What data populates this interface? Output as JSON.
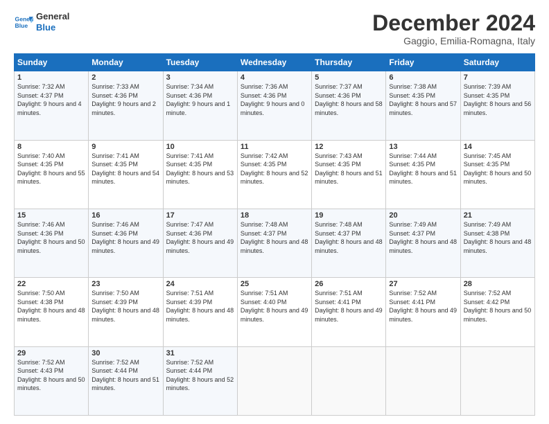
{
  "header": {
    "logo_line1": "General",
    "logo_line2": "Blue",
    "title": "December 2024",
    "subtitle": "Gaggio, Emilia-Romagna, Italy"
  },
  "weekdays": [
    "Sunday",
    "Monday",
    "Tuesday",
    "Wednesday",
    "Thursday",
    "Friday",
    "Saturday"
  ],
  "weeks": [
    [
      {
        "day": "1",
        "rise": "Sunrise: 7:32 AM",
        "set": "Sunset: 4:37 PM",
        "light": "Daylight: 9 hours and 4 minutes."
      },
      {
        "day": "2",
        "rise": "Sunrise: 7:33 AM",
        "set": "Sunset: 4:36 PM",
        "light": "Daylight: 9 hours and 2 minutes."
      },
      {
        "day": "3",
        "rise": "Sunrise: 7:34 AM",
        "set": "Sunset: 4:36 PM",
        "light": "Daylight: 9 hours and 1 minute."
      },
      {
        "day": "4",
        "rise": "Sunrise: 7:36 AM",
        "set": "Sunset: 4:36 PM",
        "light": "Daylight: 9 hours and 0 minutes."
      },
      {
        "day": "5",
        "rise": "Sunrise: 7:37 AM",
        "set": "Sunset: 4:36 PM",
        "light": "Daylight: 8 hours and 58 minutes."
      },
      {
        "day": "6",
        "rise": "Sunrise: 7:38 AM",
        "set": "Sunset: 4:35 PM",
        "light": "Daylight: 8 hours and 57 minutes."
      },
      {
        "day": "7",
        "rise": "Sunrise: 7:39 AM",
        "set": "Sunset: 4:35 PM",
        "light": "Daylight: 8 hours and 56 minutes."
      }
    ],
    [
      {
        "day": "8",
        "rise": "Sunrise: 7:40 AM",
        "set": "Sunset: 4:35 PM",
        "light": "Daylight: 8 hours and 55 minutes."
      },
      {
        "day": "9",
        "rise": "Sunrise: 7:41 AM",
        "set": "Sunset: 4:35 PM",
        "light": "Daylight: 8 hours and 54 minutes."
      },
      {
        "day": "10",
        "rise": "Sunrise: 7:41 AM",
        "set": "Sunset: 4:35 PM",
        "light": "Daylight: 8 hours and 53 minutes."
      },
      {
        "day": "11",
        "rise": "Sunrise: 7:42 AM",
        "set": "Sunset: 4:35 PM",
        "light": "Daylight: 8 hours and 52 minutes."
      },
      {
        "day": "12",
        "rise": "Sunrise: 7:43 AM",
        "set": "Sunset: 4:35 PM",
        "light": "Daylight: 8 hours and 51 minutes."
      },
      {
        "day": "13",
        "rise": "Sunrise: 7:44 AM",
        "set": "Sunset: 4:35 PM",
        "light": "Daylight: 8 hours and 51 minutes."
      },
      {
        "day": "14",
        "rise": "Sunrise: 7:45 AM",
        "set": "Sunset: 4:35 PM",
        "light": "Daylight: 8 hours and 50 minutes."
      }
    ],
    [
      {
        "day": "15",
        "rise": "Sunrise: 7:46 AM",
        "set": "Sunset: 4:36 PM",
        "light": "Daylight: 8 hours and 50 minutes."
      },
      {
        "day": "16",
        "rise": "Sunrise: 7:46 AM",
        "set": "Sunset: 4:36 PM",
        "light": "Daylight: 8 hours and 49 minutes."
      },
      {
        "day": "17",
        "rise": "Sunrise: 7:47 AM",
        "set": "Sunset: 4:36 PM",
        "light": "Daylight: 8 hours and 49 minutes."
      },
      {
        "day": "18",
        "rise": "Sunrise: 7:48 AM",
        "set": "Sunset: 4:37 PM",
        "light": "Daylight: 8 hours and 48 minutes."
      },
      {
        "day": "19",
        "rise": "Sunrise: 7:48 AM",
        "set": "Sunset: 4:37 PM",
        "light": "Daylight: 8 hours and 48 minutes."
      },
      {
        "day": "20",
        "rise": "Sunrise: 7:49 AM",
        "set": "Sunset: 4:37 PM",
        "light": "Daylight: 8 hours and 48 minutes."
      },
      {
        "day": "21",
        "rise": "Sunrise: 7:49 AM",
        "set": "Sunset: 4:38 PM",
        "light": "Daylight: 8 hours and 48 minutes."
      }
    ],
    [
      {
        "day": "22",
        "rise": "Sunrise: 7:50 AM",
        "set": "Sunset: 4:38 PM",
        "light": "Daylight: 8 hours and 48 minutes."
      },
      {
        "day": "23",
        "rise": "Sunrise: 7:50 AM",
        "set": "Sunset: 4:39 PM",
        "light": "Daylight: 8 hours and 48 minutes."
      },
      {
        "day": "24",
        "rise": "Sunrise: 7:51 AM",
        "set": "Sunset: 4:39 PM",
        "light": "Daylight: 8 hours and 48 minutes."
      },
      {
        "day": "25",
        "rise": "Sunrise: 7:51 AM",
        "set": "Sunset: 4:40 PM",
        "light": "Daylight: 8 hours and 49 minutes."
      },
      {
        "day": "26",
        "rise": "Sunrise: 7:51 AM",
        "set": "Sunset: 4:41 PM",
        "light": "Daylight: 8 hours and 49 minutes."
      },
      {
        "day": "27",
        "rise": "Sunrise: 7:52 AM",
        "set": "Sunset: 4:41 PM",
        "light": "Daylight: 8 hours and 49 minutes."
      },
      {
        "day": "28",
        "rise": "Sunrise: 7:52 AM",
        "set": "Sunset: 4:42 PM",
        "light": "Daylight: 8 hours and 50 minutes."
      }
    ],
    [
      {
        "day": "29",
        "rise": "Sunrise: 7:52 AM",
        "set": "Sunset: 4:43 PM",
        "light": "Daylight: 8 hours and 50 minutes."
      },
      {
        "day": "30",
        "rise": "Sunrise: 7:52 AM",
        "set": "Sunset: 4:44 PM",
        "light": "Daylight: 8 hours and 51 minutes."
      },
      {
        "day": "31",
        "rise": "Sunrise: 7:52 AM",
        "set": "Sunset: 4:44 PM",
        "light": "Daylight: 8 hours and 52 minutes."
      },
      null,
      null,
      null,
      null
    ]
  ]
}
